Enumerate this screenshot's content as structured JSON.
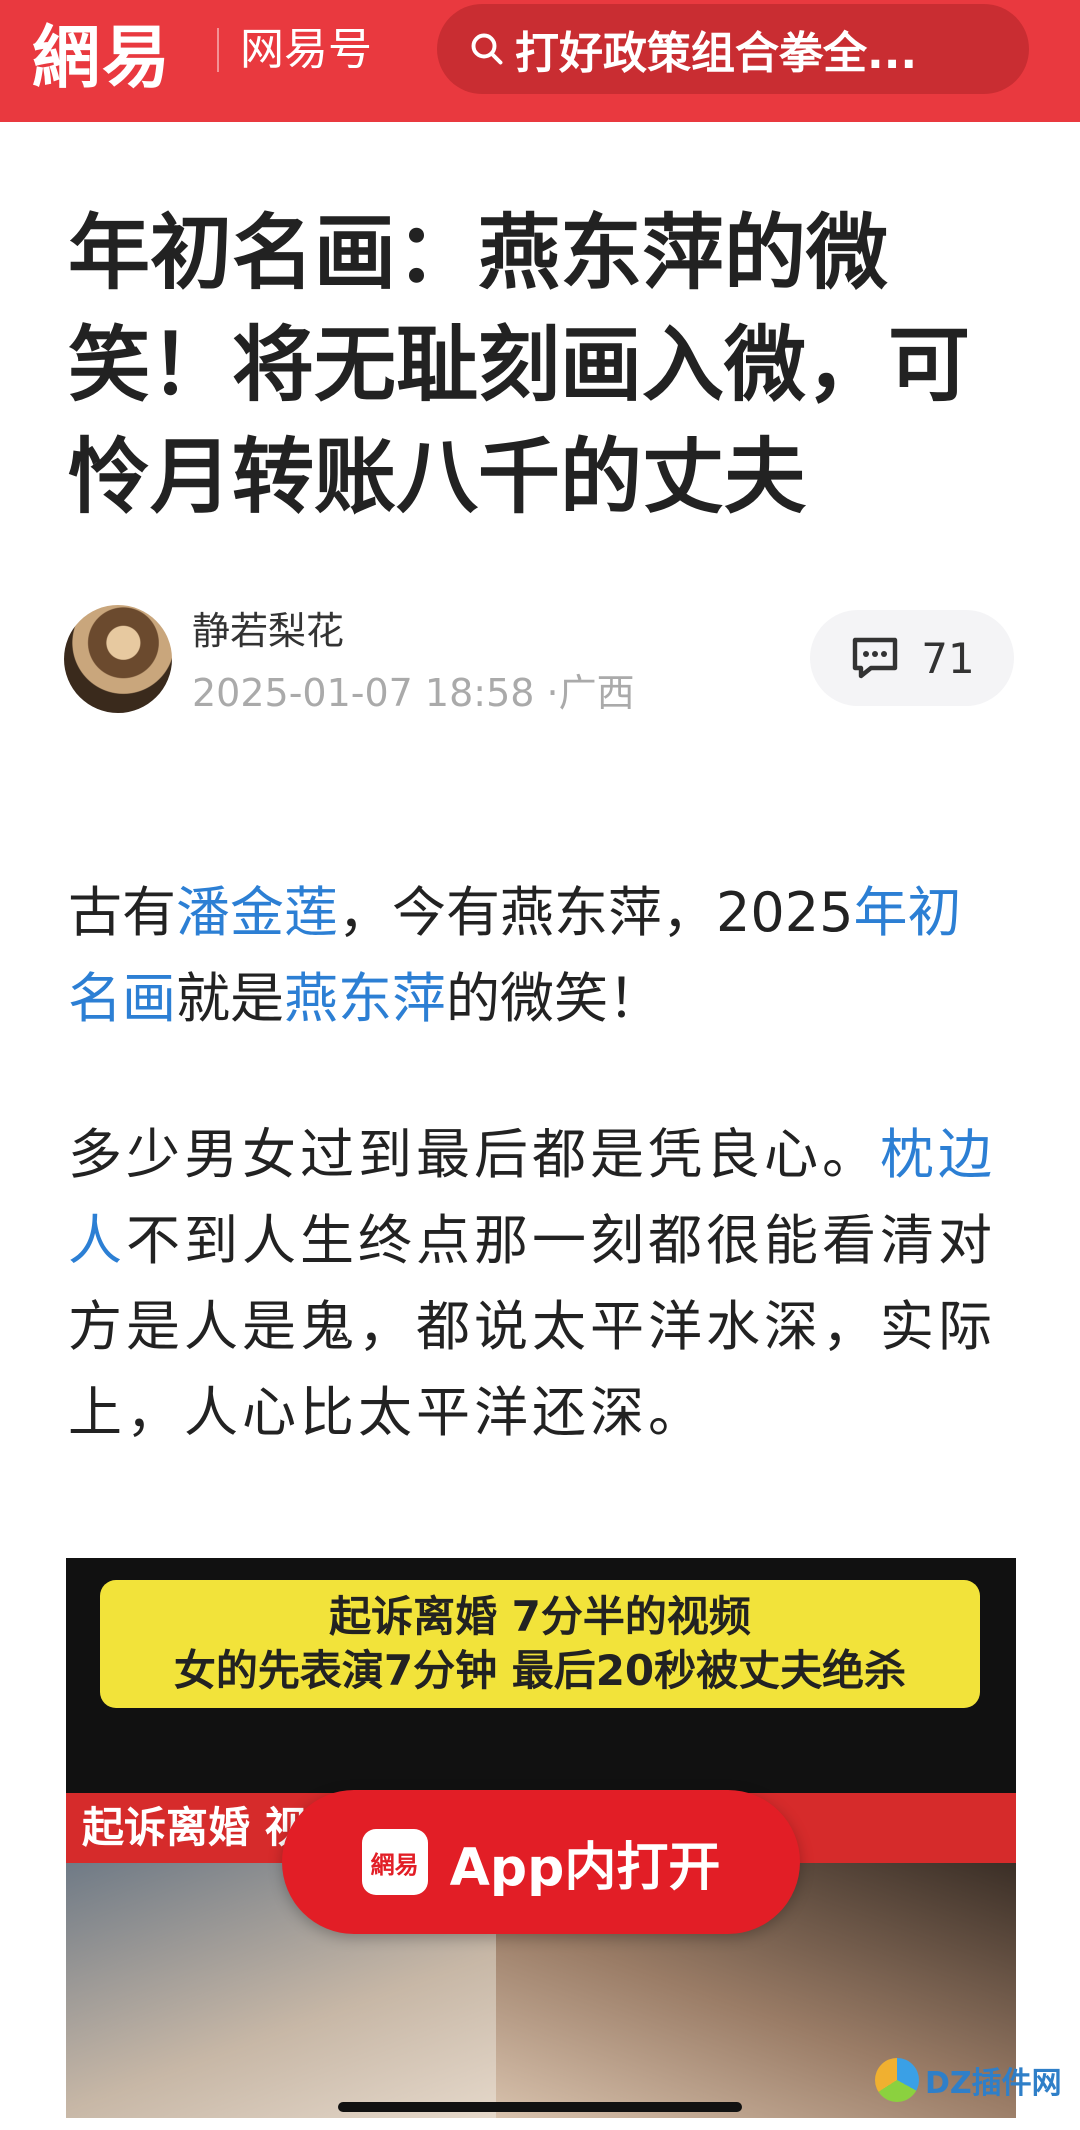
{
  "header": {
    "logo": "網易",
    "channel": "网易号",
    "search_text": "打好政策组合拳全..."
  },
  "article": {
    "title": "年初名画：燕东萍的微笑！将无耻刻画入微，可怜月转账八千的丈夫",
    "author": "静若梨花",
    "date": "2025-01-07 18:58",
    "location": "·广西",
    "comment_count": "71",
    "p1": [
      {
        "text": "古有",
        "link": false
      },
      {
        "text": "潘金莲",
        "link": true
      },
      {
        "text": "，今有燕东萍，2025",
        "link": false
      },
      {
        "text": "年初名画",
        "link": true
      },
      {
        "text": "就是",
        "link": false
      },
      {
        "text": "燕东萍",
        "link": true
      },
      {
        "text": "的微笑！",
        "link": false
      }
    ],
    "p2": [
      {
        "text": "多少男女过到最后都是凭良心。",
        "link": false
      },
      {
        "text": "枕边人",
        "link": true
      },
      {
        "text": "不到人生终点那一刻都很能看清对方是人是鬼，都说太平洋水深，实际上，人心比太平洋还深。",
        "link": false
      }
    ]
  },
  "image": {
    "caption_line1": "起诉离婚 7分半的视频",
    "caption_line2": "女的先表演7分钟 最后20秒被丈夫绝杀",
    "red_strip": "起诉离婚 视频开庭现场"
  },
  "open_app": {
    "icon_text": "網易",
    "label": "App内打开"
  },
  "watermark": {
    "text": "DZ插件网"
  }
}
